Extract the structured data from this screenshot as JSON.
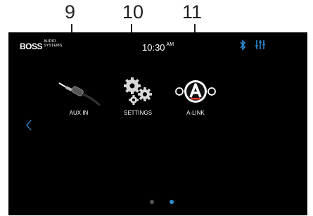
{
  "callouts": [
    "9",
    "10",
    "11"
  ],
  "status_bar": {
    "logo": "BOSS",
    "logo_sub_1": "AUDIO",
    "logo_sub_2": "SYSTEMS",
    "time": "10:30",
    "ampm": "AM",
    "icons": [
      "bluetooth-icon",
      "equalizer-icon"
    ]
  },
  "apps": [
    {
      "label": "AUX IN",
      "icon": "aux-cable-icon"
    },
    {
      "label": "SETTINGS",
      "icon": "gears-icon"
    },
    {
      "label": "A-LINK",
      "icon": "a-link-icon"
    }
  ],
  "pager": {
    "pages": 2,
    "active_index": 1
  },
  "colors": {
    "accent": "#2f8fd8",
    "background": "#000000",
    "inactive_dot": "#555555"
  }
}
